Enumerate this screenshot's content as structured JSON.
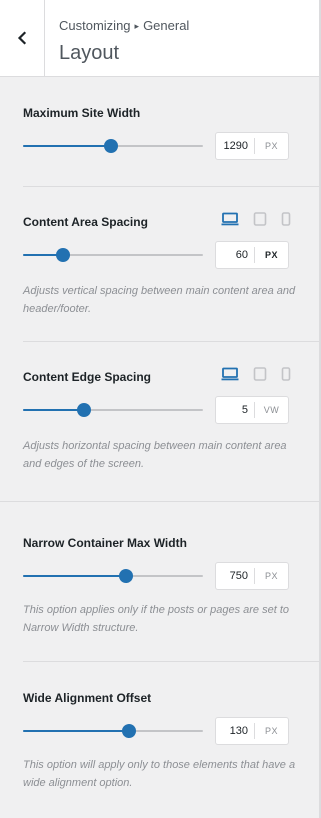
{
  "header": {
    "breadcrumb_root": "Customizing",
    "breadcrumb_separator": "▸",
    "breadcrumb_current": "General",
    "title": "Layout",
    "back_icon": "chevron-left-icon"
  },
  "colors": {
    "accent": "#2271b1",
    "track": "#c3c4c7",
    "muted": "#8c8f94"
  },
  "controls": {
    "max_site_width": {
      "label": "Maximum Site Width",
      "value": "1290",
      "unit": "PX",
      "level": 0.49
    },
    "content_area_spacing": {
      "label": "Content Area Spacing",
      "value": "60",
      "unit": "PX",
      "level": 0.22,
      "devices": [
        "desktop-icon",
        "tablet-icon",
        "mobile-icon"
      ],
      "active_device": "desktop",
      "description": "Adjusts vertical spacing between main content area and header/footer."
    },
    "content_edge_spacing": {
      "label": "Content Edge Spacing",
      "value": "5",
      "unit": "VW",
      "level": 0.34,
      "devices": [
        "desktop-icon",
        "tablet-icon",
        "mobile-icon"
      ],
      "active_device": "desktop",
      "description": "Adjusts horizontal spacing between main content area and edges of the screen."
    },
    "narrow_container_max_width": {
      "label": "Narrow Container Max Width",
      "value": "750",
      "unit": "PX",
      "level": 0.57,
      "description": "This option applies only if the posts or pages are set to Narrow Width structure."
    },
    "wide_alignment_offset": {
      "label": "Wide Alignment Offset",
      "value": "130",
      "unit": "PX",
      "level": 0.59,
      "description": "This option will apply only to those elements that have a wide alignment option."
    }
  }
}
